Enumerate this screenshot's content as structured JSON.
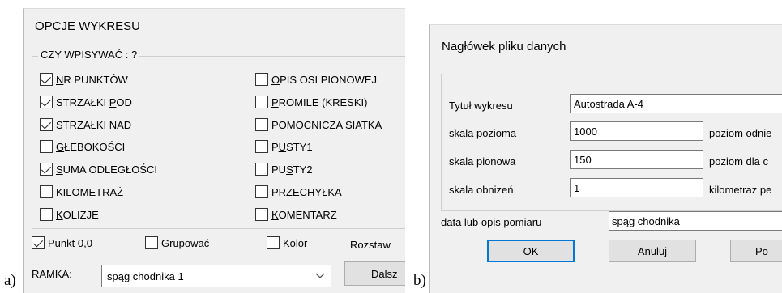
{
  "captions": {
    "a": "a)",
    "b": "b)"
  },
  "panel_a": {
    "title": "OPCJE WYKRESU",
    "group_label": "CZY WPISYWAĆ : ?",
    "left_options": [
      {
        "pre": "",
        "ul": "N",
        "post": "R PUNKTÓW",
        "checked": true
      },
      {
        "pre": "STRZAŁKI ",
        "ul": "P",
        "post": "OD",
        "checked": true
      },
      {
        "pre": "STRZAŁKI ",
        "ul": "N",
        "post": "AD",
        "checked": true
      },
      {
        "pre": "",
        "ul": "G",
        "post": "ŁEBOKOŚCI",
        "checked": false
      },
      {
        "pre": "",
        "ul": "S",
        "post": "UMA ODLEGŁOŚCI",
        "checked": true
      },
      {
        "pre": "",
        "ul": "K",
        "post": "ILOMETRAŻ",
        "checked": false
      },
      {
        "pre": "",
        "ul": "K",
        "post": "OLIZJE",
        "checked": false
      }
    ],
    "right_options": [
      {
        "pre": "",
        "ul": "O",
        "post": "PIS OSI PIONOWEJ",
        "checked": false
      },
      {
        "pre": "",
        "ul": "P",
        "post": "ROMILE (KRESKI)",
        "checked": false
      },
      {
        "pre": "",
        "ul": "P",
        "post": "OMOCNICZA SIATKA",
        "checked": false
      },
      {
        "pre": "P",
        "ul": "U",
        "post": "STY1",
        "checked": false
      },
      {
        "pre": "PU",
        "ul": "S",
        "post": "TY2",
        "checked": false
      },
      {
        "pre": "",
        "ul": "P",
        "post": "RZECHYŁKA",
        "checked": false
      },
      {
        "pre": "",
        "ul": "K",
        "post": "OMENTARZ",
        "checked": false
      }
    ],
    "bottom_options": [
      {
        "pre": "",
        "ul": "P",
        "post": "unkt 0,0",
        "checked": true
      },
      {
        "pre": "",
        "ul": "G",
        "post": "rupować",
        "checked": false
      },
      {
        "pre": "",
        "ul": "K",
        "post": "olor",
        "checked": false
      }
    ],
    "rozstaw_label": "Rozstaw",
    "ramka_label": "RAMKA:",
    "ramka_value": "spąg chodnika 1",
    "dalej_button": "Dalsz"
  },
  "panel_b": {
    "title": "Nagłówek pliku danych",
    "rows": [
      {
        "label": "Tytuł wykresu",
        "value": "Autostrada A-4",
        "right_label": ""
      },
      {
        "label": "skala pozioma",
        "value": "1000",
        "right_label": "poziom odnie"
      },
      {
        "label": "skala pionowa",
        "value": "150",
        "right_label": "poziom dla c"
      },
      {
        "label": "skala obnizeń",
        "value": "1",
        "right_label": "kilometraz pe"
      }
    ],
    "date_label": "data lub opis pomiaru",
    "date_value": "spąg chodnika",
    "ok_button": "OK",
    "cancel_button": "Anuluj",
    "third_button": "Po"
  }
}
